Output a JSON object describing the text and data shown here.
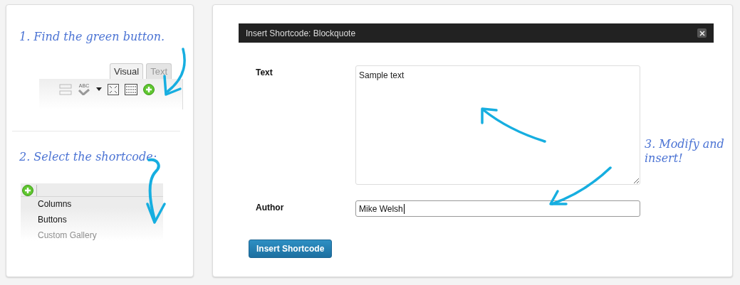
{
  "step_1": {
    "caption": "1. Find the green button.",
    "tabs": [
      {
        "label": "Visual",
        "selected": true
      },
      {
        "label": "Text",
        "selected": false
      }
    ],
    "spellcheck_label": "ABC"
  },
  "step_2": {
    "caption": "2. Select the shortcode:",
    "menu_items": [
      {
        "label": "Columns",
        "disabled": false
      },
      {
        "label": "Buttons",
        "disabled": false
      },
      {
        "label": "Custom Gallery",
        "disabled": true
      }
    ]
  },
  "dialog": {
    "title": "Insert Shortcode: Blockquote",
    "fields": [
      {
        "label": "Text",
        "kind": "textarea",
        "value": "Sample text",
        "focused": false
      },
      {
        "label": "Author",
        "kind": "input",
        "value": "Mike Welsh",
        "focused": true
      }
    ],
    "submit": "Insert Shortcode"
  },
  "step_3": {
    "caption": "3. Modify and insert!"
  }
}
